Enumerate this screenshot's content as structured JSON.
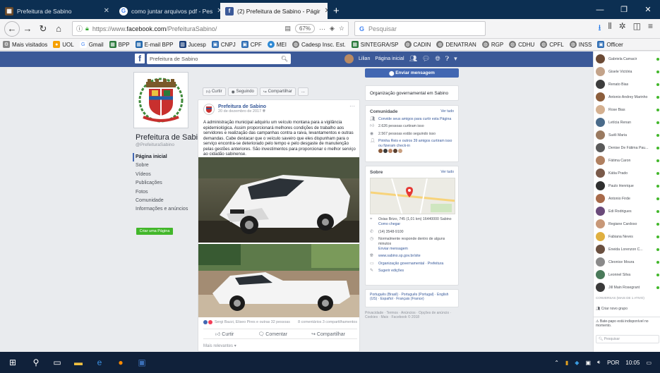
{
  "browser": {
    "tabs": [
      {
        "title": "Prefeitura de Sabino",
        "active": false
      },
      {
        "title": "como juntar arquivos pdf - Pes",
        "active": false
      },
      {
        "title": "(2) Prefeitura de Sabino - Págir",
        "active": true
      }
    ],
    "new_tab": "+",
    "url_protocol": "https://www.",
    "url_host": "facebook.com",
    "url_path": "/PrefeituraSabino/",
    "zoom": "67%",
    "search_placeholder": "Pesquisar",
    "bookmarks": [
      "Mais visitados",
      "UOL",
      "Gmail",
      "BPP",
      "E-mail BPP",
      "Jucesp",
      "CNPJ",
      "CPF",
      "MEI",
      "Cadesp Insc. Est.",
      "SINTEGRA/SP",
      "CADIN",
      "DENATRAN",
      "RGP",
      "CDHU",
      "CPFL",
      "INSS",
      "Officer"
    ]
  },
  "facebook": {
    "search_value": "Prefeitura de Sabino",
    "user_name": "Lilian",
    "home_label": "Página inicial",
    "page_name": "Prefeitura de Sabino",
    "page_handle": "@PrefeituraSabino",
    "left_nav": [
      "Página inicial",
      "Sobre",
      "Vídeos",
      "Publicações",
      "Fotos",
      "Comunidade",
      "Informações e anúncios"
    ],
    "create_page": "Criar uma Página",
    "actions": [
      "Curtir",
      "Seguindo",
      "Compartilhar",
      "..."
    ],
    "post": {
      "author": "Prefeitura de Sabino",
      "date": "20 de dezembro de 2017",
      "text": "A administração municipal adquiriu um veículo montana para a vigilância epidemiológica. Assim proporcionará melhores condições de trabalho aos servidores e realização das campanhas contra a raiva, levantamentos e outras demandas. Cabe destacar que o veículo saveiro que eles dispunham para o serviço encontra-se deteriorado pelo tempo e pelo desgaste de manutenção pelas gestões anteriores. São investimentos para proporcionar o melhor serviço ao cidadão sabinense.",
      "reactions": "Sergi Bazzi, Eliseo Pires e outras 32 pessoas",
      "comments_shares": "8 comentários  3 compartilhamentos",
      "buttons": [
        "Curtir",
        "Comentar",
        "Compartilhar"
      ],
      "more": "Mais relevantes"
    },
    "send_message": "Enviar mensagem",
    "category": "Organização governamental em Sabino",
    "community": {
      "title": "Comunidade",
      "see_all": "Ver tudo",
      "items": [
        "Convide seus amigos para curtir esta Página",
        "2.626 pessoas curtiram isso",
        "2.567 pessoas estão seguindo isso",
        "Pirinha Reis e outros 39 amigos curtiram isso ou fizeram check-in"
      ]
    },
    "about": {
      "title": "Sobre",
      "see_all": "Ver tudo",
      "items": [
        "Osias Brizo, 745 (1,01 km) 16440000 Sabino",
        "Como chegar",
        "(14) 3548-9100",
        "Normalmente responde dentro de alguns minutos",
        "Enviar mensagem",
        "www.sabino.sp.gov.br/site",
        "Organização governamental · Prefeitura",
        "Sugerir edições"
      ]
    },
    "languages": "Português (Brasil) · Português (Portugal) · English (US) · Español · Français (France)",
    "footer": "Privacidade · Termos · Anúncios · Opções de anúncio · Cookies · Mais · Facebook © 2018"
  },
  "chat": {
    "contacts": [
      "Gabriela Camacir",
      "Gisele Victória",
      "Renato Bias",
      "Antonio Andrey Marinho",
      "Rose Bias",
      "Letícia Renan",
      "Suéli Maria",
      "Denise De Fátima Pau...",
      "Fátima Caron",
      "Kátia Prado",
      "Paulo Henrique",
      "Antonio Firde",
      "Edi Rodrigues",
      "Regiane Cardoso",
      "Fabiana Neves",
      "Eneida Lorenzon C...",
      "Cleonice Moura",
      "Leonnel Silva",
      "Jill Main Rosegrant"
    ],
    "more_contacts": "CONVERSAS (MAIS DE 1 ATIVO)",
    "new_group": "Criar novo grupo",
    "notice": "Bate-papo está indisponível no momento.",
    "search_placeholder": "Pesquisar"
  },
  "taskbar": {
    "lang": "POR",
    "time": "10:05"
  }
}
